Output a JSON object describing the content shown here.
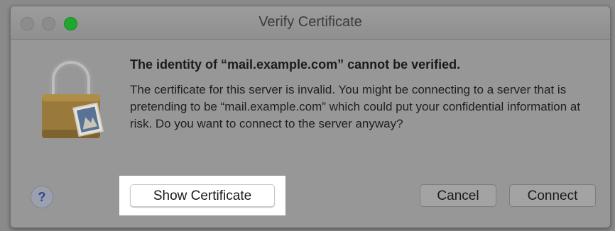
{
  "window": {
    "title": "Verify Certificate"
  },
  "dialog": {
    "heading": "The identity of “mail.example.com” cannot be verified.",
    "message": "The certificate for this server is invalid. You might be connecting to a server that is pretending to be “mail.example.com” which could put your confidential information at risk. Do you want to connect to the server anyway?",
    "icon": "padlock-with-mail-stamp-icon"
  },
  "buttons": {
    "help": "?",
    "show_certificate": "Show Certificate",
    "cancel": "Cancel",
    "connect": "Connect"
  },
  "colors": {
    "zoom_button": "#1fa82f",
    "highlight": "#ffffff"
  }
}
